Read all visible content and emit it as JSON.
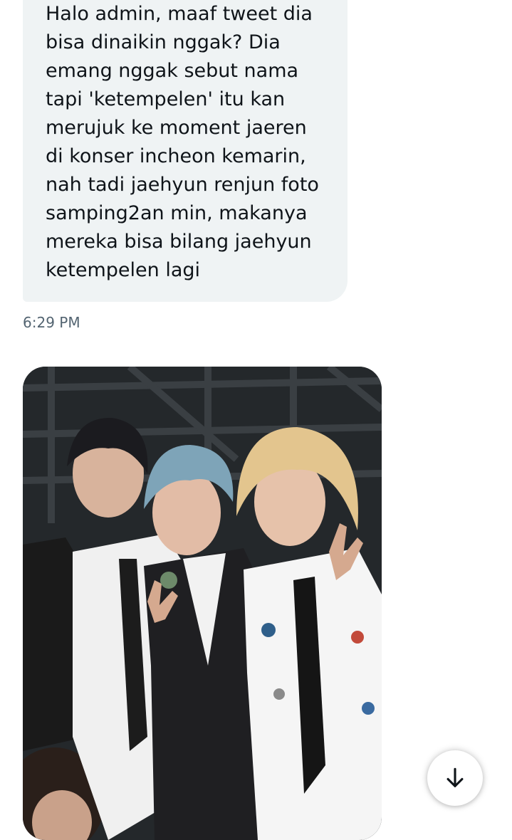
{
  "conversation": {
    "messages": [
      {
        "direction": "incoming",
        "text": "Halo admin, maaf tweet dia\nbisa dinaikin nggak? Dia\nemang nggak sebut nama\ntapi 'ketempelen' itu kan\nmerujuk ke moment jaeren\ndi konser incheon kemarin,\nnah tadi jaehyun renjun foto\nsamping2an min, makanya\nmereka bisa bilang jaehyun\nketempelen lagi",
        "timestamp": "6:29 PM"
      },
      {
        "direction": "incoming",
        "type": "image"
      }
    ]
  },
  "colors": {
    "bubble_bg": "#eff3f4",
    "text": "#0f1419",
    "timestamp": "#536471",
    "page_bg": "#ffffff"
  },
  "controls": {
    "scroll_button_icon": "arrow-down-icon"
  }
}
